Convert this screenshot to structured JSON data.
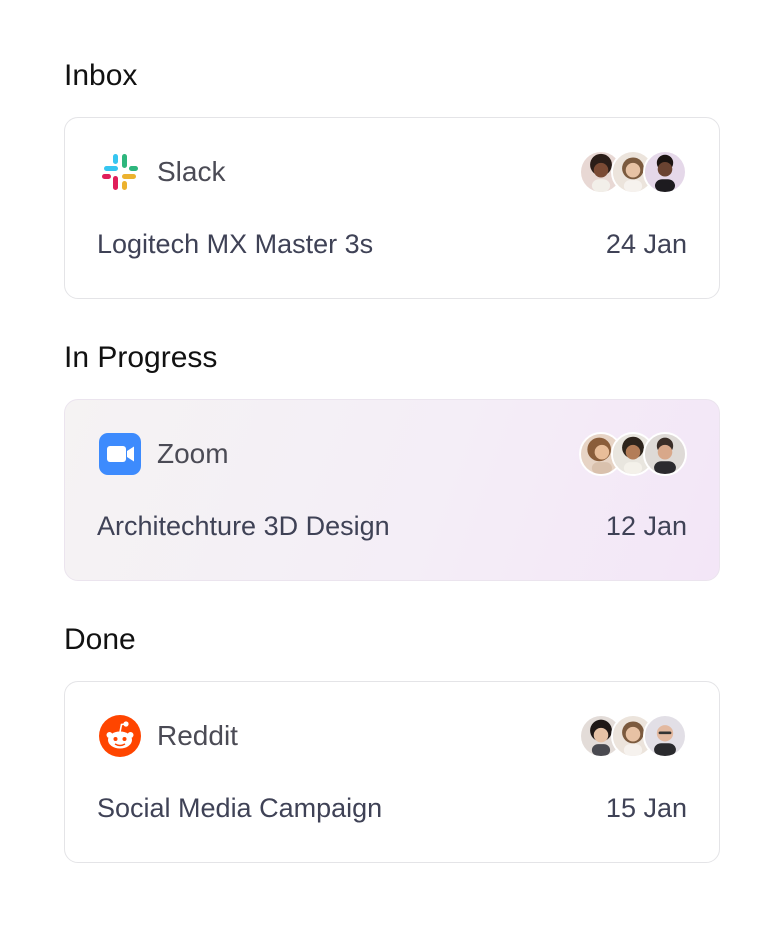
{
  "sections": [
    {
      "title": "Inbox",
      "card": {
        "app": "Slack",
        "icon": "slack-icon",
        "task": "Logitech MX Master 3s",
        "date": "24 Jan",
        "active": false
      }
    },
    {
      "title": "In Progress",
      "card": {
        "app": "Zoom",
        "icon": "zoom-icon",
        "task": "Architechture 3D Design",
        "date": "12 Jan",
        "active": true
      }
    },
    {
      "title": "Done",
      "card": {
        "app": "Reddit",
        "icon": "reddit-icon",
        "task": "Social Media Campaign",
        "date": "15 Jan",
        "active": false
      }
    }
  ],
  "colors": {
    "zoom_blue": "#3d8bfd",
    "reddit_orange": "#ff4500",
    "slack_blue": "#36c5f0",
    "slack_green": "#2eb67d",
    "slack_yellow": "#ecb22e",
    "slack_red": "#e01e5a"
  }
}
